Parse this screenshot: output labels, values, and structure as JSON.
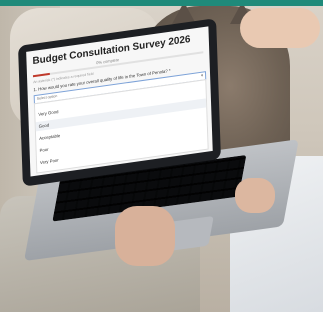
{
  "survey": {
    "title": "Budget Consultation Survey 2026",
    "subtitle": "0% complete",
    "required_note": "An asterisk (*) indicates a required field",
    "question": "1. How would you rate your overall quality of life in the Town of Penola? *",
    "dropdown_label": "Select option",
    "options": [
      "Very Good",
      "Good",
      "Acceptable",
      "Poor",
      "Very Poor"
    ],
    "selected_option": "Good",
    "progress_percent": 10
  },
  "colors": {
    "header_bar": "#1f8a7a",
    "progress_fill": "#c0392b",
    "dropdown_border": "#7ea3d8"
  }
}
